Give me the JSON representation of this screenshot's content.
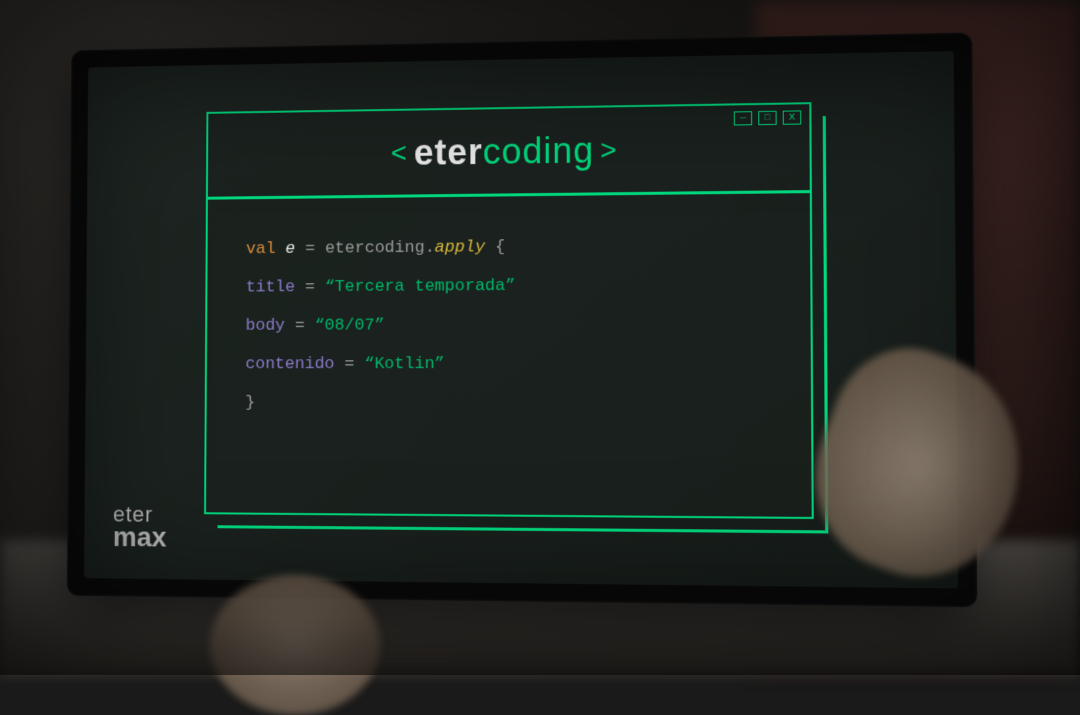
{
  "brand": {
    "left_bracket": "<",
    "part1": "eter",
    "part2": "coding",
    "right_bracket": ">"
  },
  "code": {
    "line1": {
      "keyword": "val",
      "var": "e",
      "op": "=",
      "object": "etercoding",
      "dot": ".",
      "method": "apply",
      "brace_open": "{"
    },
    "line2": {
      "prop": "title",
      "op": "=",
      "value": "“Tercera temporada”"
    },
    "line3": {
      "prop": "body",
      "op": "=",
      "value": "“08/07”"
    },
    "line4": {
      "prop": "contenido",
      "op": "=",
      "value": "“Kotlin”"
    },
    "line5": {
      "brace_close": "}"
    }
  },
  "logo": {
    "line1": "eter",
    "line2": "max"
  }
}
